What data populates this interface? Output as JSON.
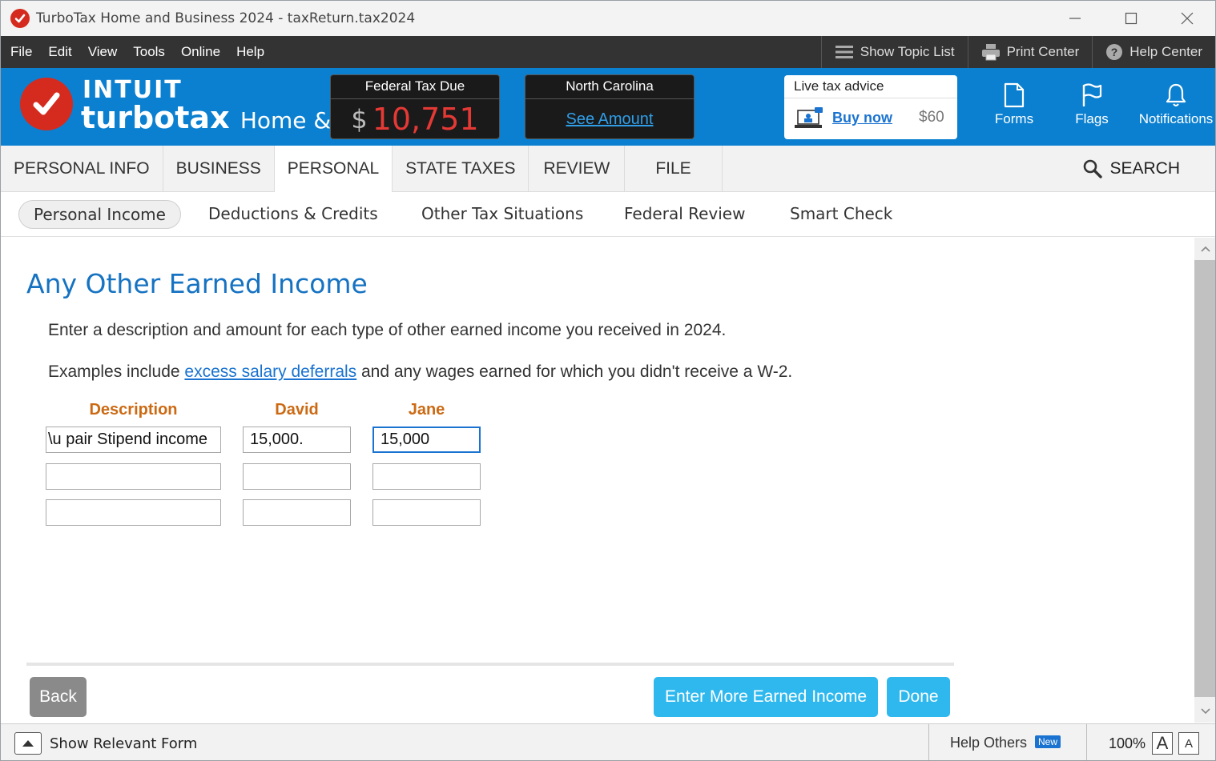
{
  "window": {
    "title": "TurboTax Home and Business 2024 - taxReturn.tax2024"
  },
  "menu": {
    "items": [
      "File",
      "Edit",
      "View",
      "Tools",
      "Online",
      "Help"
    ],
    "tools": {
      "topic_list": "Show Topic List",
      "print_center": "Print Center",
      "help_center": "Help Center"
    }
  },
  "header": {
    "brand_intuit": "INTUIT",
    "brand_turbotax": "turbotax",
    "brand_edition": "Home & Bu",
    "federal": {
      "label": "Federal Tax Due",
      "currency": "$",
      "amount": "10,751"
    },
    "state": {
      "label": "North Carolina",
      "link": "See Amount"
    },
    "advice": {
      "title": "Live tax advice",
      "buy": "Buy now",
      "price": "$60"
    },
    "tools": {
      "forms": "Forms",
      "flags": "Flags",
      "notifications": "Notifications"
    },
    "colors": {
      "bar": "#0b80d0",
      "tax_due": "#e53935",
      "brand_red": "#d52b1e"
    }
  },
  "main_tabs": {
    "personal_info": "PERSONAL INFO",
    "business": "BUSINESS",
    "personal": "PERSONAL",
    "state_taxes": "STATE TAXES",
    "review": "REVIEW",
    "file": "FILE",
    "search": "SEARCH"
  },
  "sub_tabs": {
    "personal_income": "Personal Income",
    "deductions": "Deductions & Credits",
    "other_tax": "Other Tax Situations",
    "federal_review": "Federal Review",
    "smart_check": "Smart Check"
  },
  "page": {
    "title": "Any Other Earned Income",
    "intro": "Enter a description and amount for each type of other earned income you received in 2024.",
    "examples_prefix": "Examples include ",
    "examples_link": "excess salary deferrals",
    "examples_suffix": " and any wages earned for which you didn't receive a W-2.",
    "columns": {
      "description": "Description",
      "david": "David",
      "jane": "Jane"
    },
    "rows": [
      {
        "description": "Au pair Stipend income",
        "description_visible": "\\u pair Stipend income",
        "david": "15,000.",
        "jane": "15,000"
      },
      {
        "description": "",
        "david": "",
        "jane": ""
      },
      {
        "description": "",
        "david": "",
        "jane": ""
      }
    ],
    "buttons": {
      "back": "Back",
      "more": "Enter More Earned Income",
      "done": "Done"
    }
  },
  "status": {
    "relevant_form": "Show Relevant Form",
    "help_others": "Help Others",
    "new_badge": "New",
    "zoom": "100%",
    "font_large": "A",
    "font_small": "A"
  }
}
